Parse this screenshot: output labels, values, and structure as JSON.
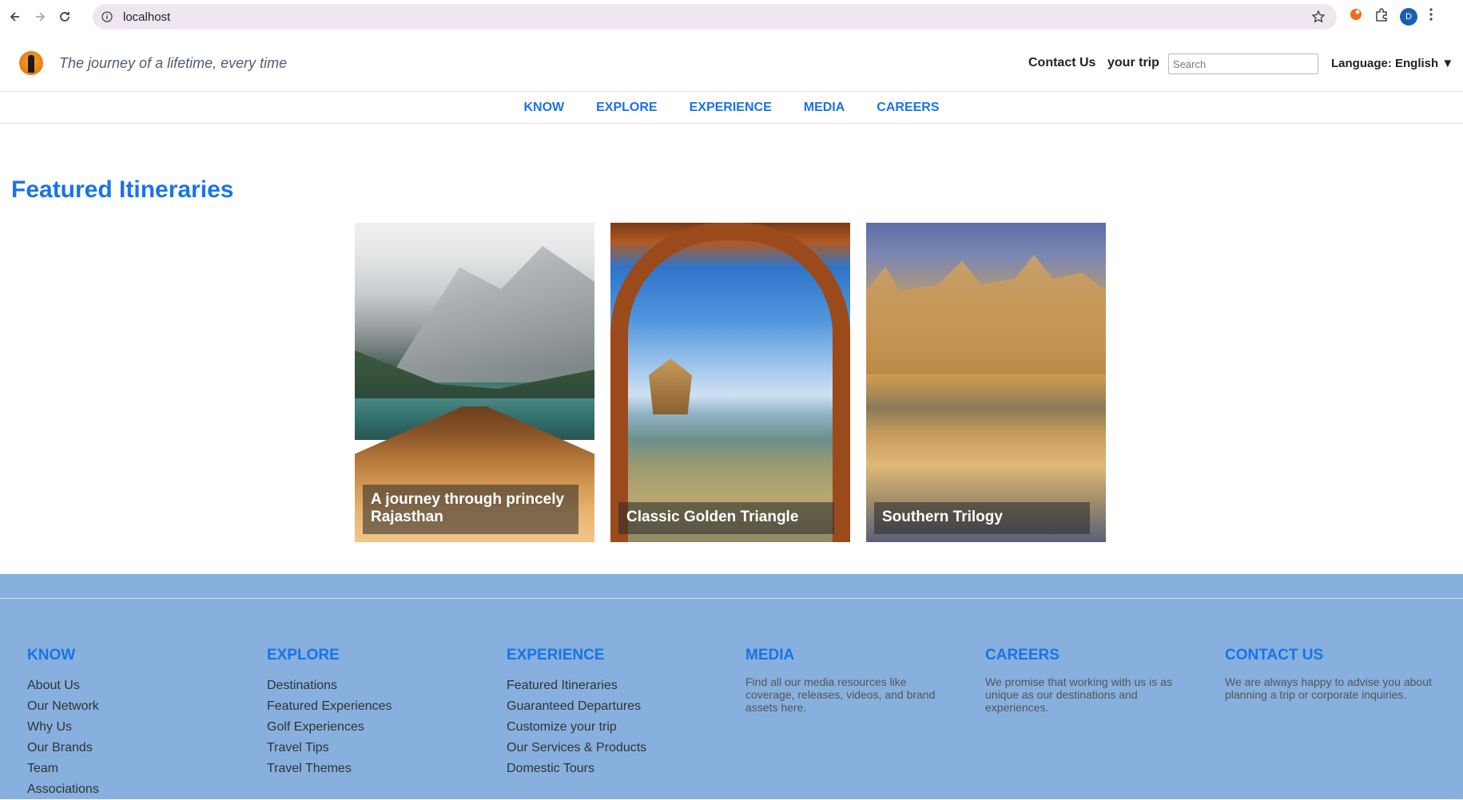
{
  "browser": {
    "url": "localhost",
    "profile_initial": "D"
  },
  "header": {
    "tagline": "The journey of a lifetime, every time",
    "contact_label": "Contact Us",
    "trip_label": "your trip",
    "search_placeholder": "Search",
    "language_label": "Language: English ▼"
  },
  "nav": {
    "items": [
      "KNOW",
      "EXPLORE",
      "EXPERIENCE",
      "MEDIA",
      "CAREERS"
    ]
  },
  "featured": {
    "title": "Featured Itineraries",
    "cards": [
      {
        "title": "A journey through princely Rajasthan"
      },
      {
        "title": "Classic Golden Triangle"
      },
      {
        "title": "Southern Trilogy"
      }
    ]
  },
  "footer": {
    "know": {
      "heading": "KNOW",
      "items": [
        "About Us",
        "Our Network",
        "Why Us",
        "Our Brands",
        "Team",
        "Associations"
      ]
    },
    "explore": {
      "heading": "EXPLORE",
      "items": [
        "Destinations",
        "Featured Experiences",
        "Golf Experiences",
        "Travel Tips",
        "Travel Themes"
      ]
    },
    "experience": {
      "heading": "EXPERIENCE",
      "items": [
        "Featured Itineraries",
        "Guaranteed Departures",
        "Customize your trip",
        "Our Services & Products",
        "Domestic Tours"
      ]
    },
    "media": {
      "heading": "MEDIA",
      "text": "Find all our media resources like coverage, releases, videos, and brand assets here."
    },
    "careers": {
      "heading": "CAREERS",
      "text": "We promise that working with us is as unique as our destinations and experiences."
    },
    "contact": {
      "heading": "CONTACT US",
      "text": "We are always happy to advise you about planning a trip or corporate inquiries."
    }
  },
  "colors": {
    "accent": "#1a73e8",
    "footer_bg": "#87b0de"
  }
}
